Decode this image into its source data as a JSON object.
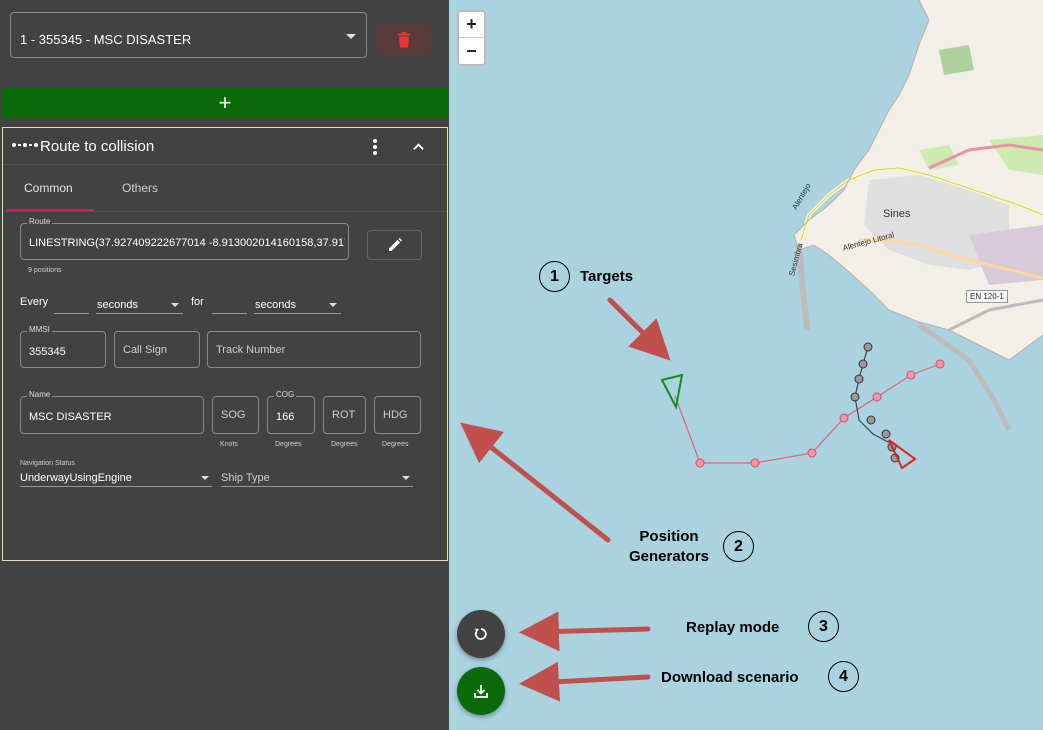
{
  "target_selector": {
    "value": "1 - 355345 - MSC DISASTER"
  },
  "add_button": {
    "label": "+"
  },
  "card": {
    "title": "Route to collision",
    "tabs": [
      {
        "label": "Common",
        "active": true
      },
      {
        "label": "Others",
        "active": false
      }
    ],
    "route": {
      "label": "Route",
      "value": "LINESTRING(37.927409222677014 -8.913002014160158,37.917388",
      "hint": "9 positions"
    },
    "every_label": "Every",
    "every_unit": "seconds",
    "for_label": "for",
    "for_unit": "seconds",
    "mmsi": {
      "label": "MMSI",
      "value": "355345"
    },
    "call_sign": {
      "placeholder": "Call Sign"
    },
    "track_number": {
      "placeholder": "Track Number"
    },
    "name": {
      "label": "Name",
      "value": "MSC DISASTER"
    },
    "sog": {
      "placeholder": "SOG",
      "unit": "Knots"
    },
    "cog": {
      "label": "COG",
      "value": "166",
      "unit": "Degrees"
    },
    "rot": {
      "placeholder": "ROT",
      "unit": "Degrees"
    },
    "hdg": {
      "placeholder": "HDG",
      "unit": "Degrees"
    },
    "nav_status": {
      "label": "Navigation Status",
      "value": "UnderwayUsingEngine"
    },
    "ship_type": {
      "placeholder": "Ship Type"
    }
  },
  "map": {
    "zoom_in": "+",
    "zoom_out": "−",
    "labels": {
      "town": "Sines",
      "road1": "Alentejo",
      "road2": "Alentejo Litoral",
      "road3": "Sesimbra",
      "road_badge": "EN 120-1"
    }
  },
  "fabs": {
    "replay_icon": "replay-icon",
    "download_icon": "download-icon"
  },
  "annotations": [
    {
      "number": "1",
      "text": "Targets"
    },
    {
      "number": "2",
      "text_line1": "Position",
      "text_line2": "Generators"
    },
    {
      "number": "3",
      "text": "Replay mode"
    },
    {
      "number": "4",
      "text": "Download scenario"
    }
  ],
  "colors": {
    "panel": "#424242",
    "accent_green": "#0b6b0b",
    "tab_ink": "#d81b60",
    "sea": "#aad3df",
    "arrow": "#c0504d",
    "route_pink": "#e0607a",
    "route_black": "#444444"
  }
}
